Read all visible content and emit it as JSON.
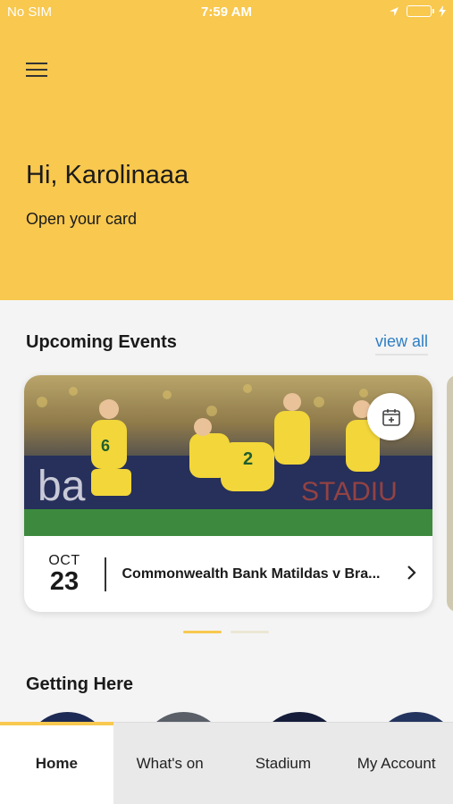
{
  "status_bar": {
    "carrier": "No SIM",
    "time": "7:59 AM"
  },
  "header": {
    "greeting": "Hi, Karolinaaa",
    "open_card": "Open your card",
    "background_color": "#f8c84f"
  },
  "upcoming": {
    "title": "Upcoming Events",
    "view_all": "view all",
    "events": [
      {
        "month": "OCT",
        "day": "23",
        "name": "Commonwealth Bank Matildas v Bra..."
      }
    ],
    "pager": {
      "total": 2,
      "active": 0
    }
  },
  "getting_here": {
    "title": "Getting Here"
  },
  "tabs": [
    {
      "label": "Home",
      "active": true
    },
    {
      "label": "What's on",
      "active": false
    },
    {
      "label": "Stadium",
      "active": false
    },
    {
      "label": "My Account",
      "active": false
    }
  ],
  "icons": {
    "menu": "hamburger-icon",
    "calendar": "calendar-add-icon",
    "chevron": "chevron-right-icon",
    "location": "location-arrow-icon",
    "battery": "battery-icon",
    "charging": "charging-bolt-icon"
  },
  "colors": {
    "accent": "#f8c84f",
    "link": "#2f7ec4"
  }
}
